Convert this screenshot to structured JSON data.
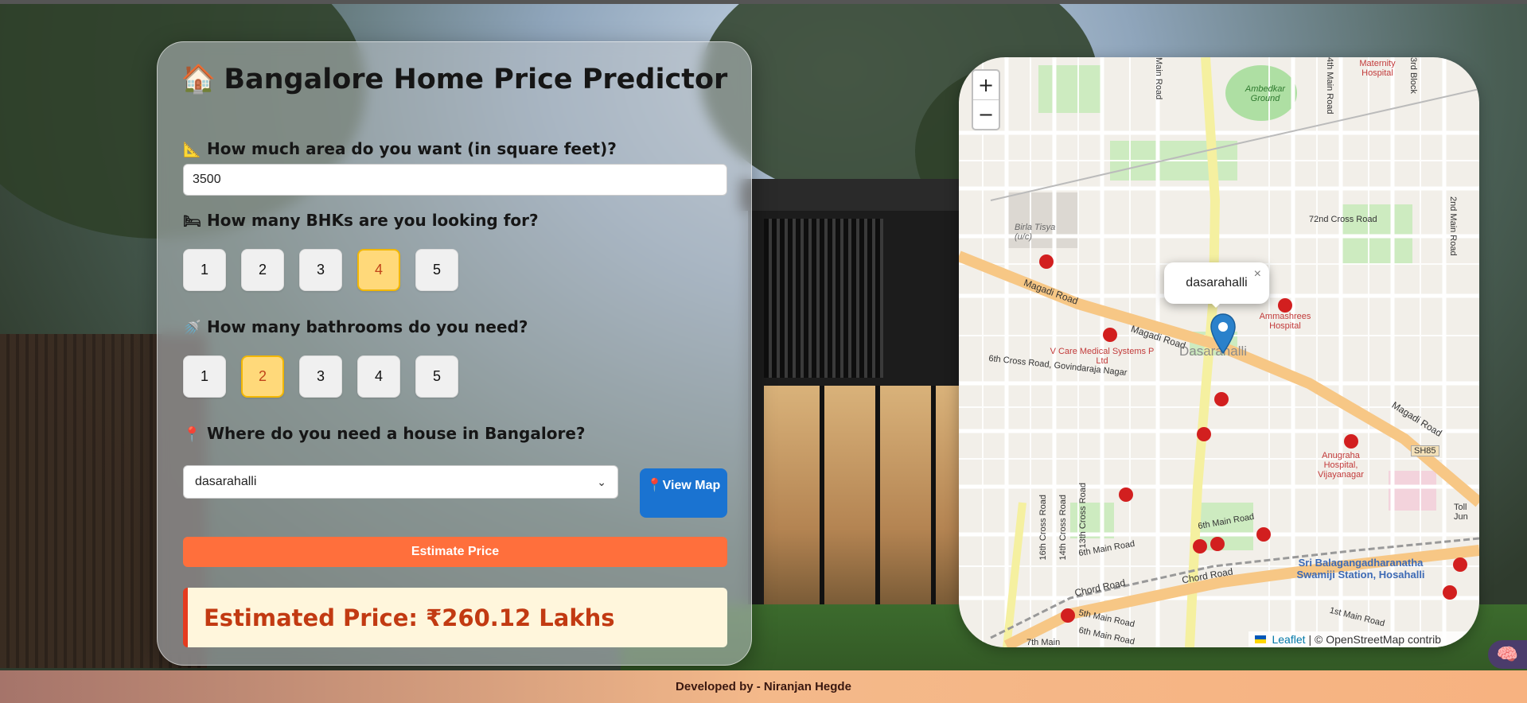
{
  "app": {
    "title": "Bangalore Home Price Predictor",
    "title_icon": "house-emoji"
  },
  "area": {
    "label": "How much area do you want (in square feet)?",
    "icon": "triangle-ruler-icon",
    "value": "3500"
  },
  "bhk": {
    "label": "How many BHKs are you looking for?",
    "icon": "bed-icon",
    "options": [
      "1",
      "2",
      "3",
      "4",
      "5"
    ],
    "selected": "4"
  },
  "bath": {
    "label": "How many bathrooms do you need?",
    "icon": "shower-icon",
    "options": [
      "1",
      "2",
      "3",
      "4",
      "5"
    ],
    "selected": "2"
  },
  "location": {
    "label": "Where do you need a house in Bangalore?",
    "icon": "pin-icon",
    "selected": "dasarahalli"
  },
  "buttons": {
    "view_map": "View Map",
    "estimate": "Estimate Price"
  },
  "result": {
    "text": "Estimated Price: ₹260.12 Lakhs"
  },
  "map": {
    "zoom_in": "+",
    "zoom_out": "−",
    "popup_text": "dasarahalli",
    "popup_close": "×",
    "attribution_leaflet": "Leaflet",
    "attribution_rest": "| © OpenStreetMap contrib",
    "labels": {
      "maternity": "Maternity Hospital",
      "ambedkar": "Ambedkar Ground",
      "birla": "Birla Tisya (u/c)",
      "cross72": "72nd Cross Road",
      "magadi1": "Magadi Road",
      "magadi2": "Magadi Road",
      "magadi3": "Magadi Road",
      "ammashrees": "Ammashrees Hospital",
      "vcare": "V Care Medical Systems P Ltd",
      "dasarahalli": "Dasarahalli",
      "govindaraja": "6th Cross Road, Govindaraja Nagar",
      "anugraha": "Anugraha Hospital, Vijayanagar",
      "sh85": "SH85",
      "sixthmain": "6th Main Road",
      "sixthmain2": "6th Main Road",
      "chord1": "Chord Road",
      "chord2": "Chord Road",
      "srib": "Sri Balagangadharanatha Swamiji Station, Hosahalli",
      "fifthmain": "5th Main Road",
      "sixthmainr": "6th Main Road",
      "firstmain": "1st Main Road",
      "seventhmain": "7th Main",
      "mainroad": "Main Road",
      "fourthmain": "4th Main Road",
      "thirdblock": "3rd Block",
      "secondmain": "2nd Main Road",
      "cross16": "16th Cross Road",
      "cross14": "14th Cross Road",
      "cross13": "13th Cross Road",
      "toll": "Toll Jun"
    }
  },
  "footer": {
    "text": "Developed by - Niranjan Hegde"
  }
}
